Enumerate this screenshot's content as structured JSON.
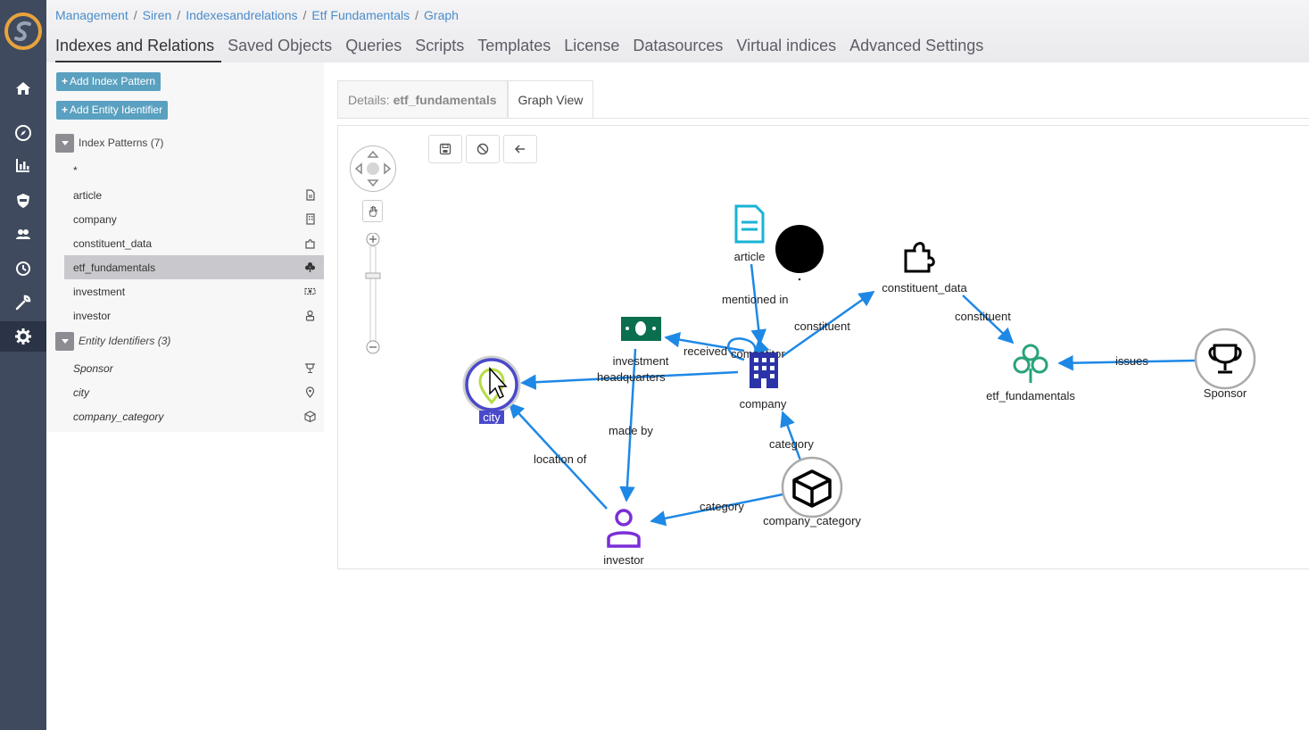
{
  "breadcrumb": [
    "Management",
    "Siren",
    "Indexesandrelations",
    "Etf Fundamentals",
    "Graph"
  ],
  "tabs": [
    "Indexes and Relations",
    "Saved Objects",
    "Queries",
    "Scripts",
    "Templates",
    "License",
    "Datasources",
    "Virtual indices",
    "Advanced Settings"
  ],
  "panel": {
    "add_index_pattern": "Add Index Pattern",
    "add_entity_identifier": "Add Entity Identifier",
    "index_patterns_header": "Index Patterns (7)",
    "index_patterns": [
      {
        "label": "*",
        "icon": ""
      },
      {
        "label": "article",
        "icon": "document-icon"
      },
      {
        "label": "company",
        "icon": "building-icon"
      },
      {
        "label": "constituent_data",
        "icon": "puzzle-icon"
      },
      {
        "label": "etf_fundamentals",
        "icon": "club-icon"
      },
      {
        "label": "investment",
        "icon": "money-icon"
      },
      {
        "label": "investor",
        "icon": "user-icon"
      }
    ],
    "entity_identifiers_header": "Entity Identifiers (3)",
    "entity_identifiers": [
      {
        "label": "Sponsor",
        "icon": "trophy-icon"
      },
      {
        "label": "city",
        "icon": "map-pin-icon"
      },
      {
        "label": "company_category",
        "icon": "cube-icon"
      }
    ]
  },
  "graph_tabs": {
    "details_prefix": "Details:",
    "details_name": "etf_fundamentals",
    "graph_view": "Graph View"
  },
  "graph": {
    "nodes": {
      "article": "article",
      "constituent_data": "constituent_data",
      "investment": "investment",
      "company": "company",
      "etf_fundamentals": "etf_fundamentals",
      "sponsor": "Sponsor",
      "city": "city",
      "investor": "investor",
      "company_category": "company_category"
    },
    "edges": {
      "mentioned_in": "mentioned in",
      "constituent_1": "constituent",
      "constituent_2": "constituent",
      "received": "received",
      "competitor": "competitor",
      "issues": "issues",
      "headquarters": "headquarters",
      "made_by": "made by",
      "location_of": "location of",
      "category_1": "category",
      "category_2": "category"
    }
  },
  "colors": {
    "rail": "#3f4a5e",
    "link": "#4a8cc9",
    "edge": "#1e88e5",
    "add_button": "#5aa0c0"
  }
}
